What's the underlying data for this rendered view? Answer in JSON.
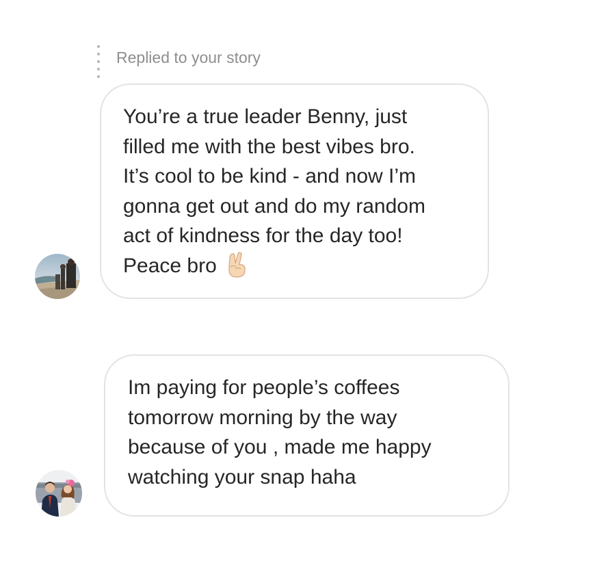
{
  "story_reply": {
    "label": "Replied to your story"
  },
  "messages": [
    {
      "lines": [
        "You’re a true leader Benny, just",
        "filled me with the best vibes bro.",
        "It’s cool to be kind - and now I’m",
        "gonna get out and do my random",
        "act of kindness for the day too!",
        "Peace bro"
      ],
      "emoji": "victory-hand-emoji"
    },
    {
      "lines": [
        "Im paying for people’s coffees",
        "tomorrow morning by the way",
        "because of you , made me happy",
        "watching your snap haha"
      ]
    }
  ],
  "colors": {
    "bubble_border": "#e3e3e3",
    "text": "#262626",
    "meta_text": "#8e8e8e",
    "background": "#ffffff"
  }
}
